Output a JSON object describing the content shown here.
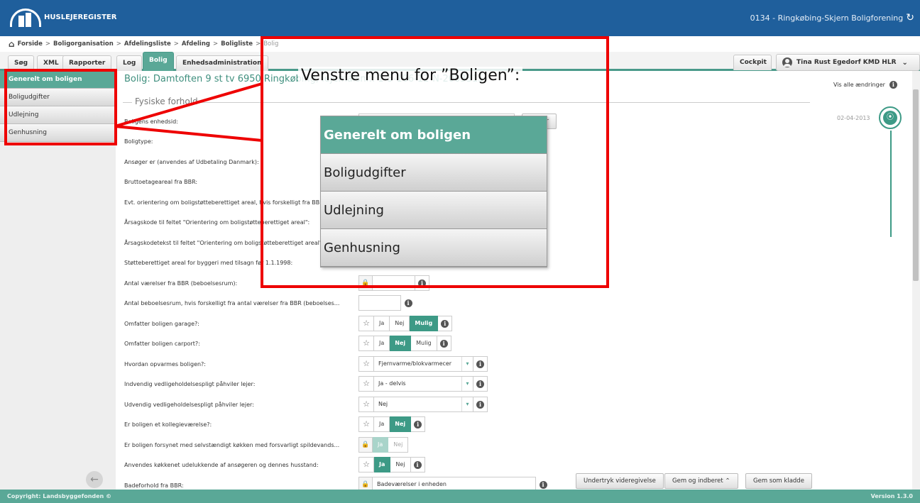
{
  "app": {
    "name": "HUSLEJEREGISTER",
    "organization": "0134 - Ringkøbing-Skjern Boligforening"
  },
  "breadcrumb": {
    "items": [
      "Forside",
      "Boligorganisation",
      "Afdelingsliste",
      "Afdeling",
      "Boligliste"
    ],
    "separator": ">",
    "current": "Bolig"
  },
  "tabs": [
    "Søg",
    "XML",
    "Rapporter",
    "Log",
    "Bolig",
    "Enhedsadministration"
  ],
  "active_tab": "Bolig",
  "top_right": {
    "cockpit": "Cockpit",
    "user": "Tina Rust Egedorf KMD HLR"
  },
  "sidebar": {
    "items": [
      {
        "label": "Generelt om boligen",
        "active": true
      },
      {
        "label": "Boligudgifter",
        "active": false
      },
      {
        "label": "Udlejning",
        "active": false
      },
      {
        "label": "Genhusning",
        "active": false
      }
    ]
  },
  "main": {
    "title": "Bolig: Damtoften 9 st tv 6950 Ringkøbing, lejemålsnr.: 1-5-106-12-N-2003315",
    "section": "Fysiske forhold",
    "rows": [
      {
        "label": "Boligens enhedsid:"
      },
      {
        "label": "Boligtype:"
      },
      {
        "label": "Ansøger er (anvendes af Udbetaling Danmark):"
      },
      {
        "label": "Bruttoetageareal fra BBR:"
      },
      {
        "label": "Evt. orientering om boligstøtteberettiget areal, hvis forskelligt fra BBR:"
      },
      {
        "label": "Årsagskode til feltet \"Orientering om boligstøtteberettiget areal\":"
      },
      {
        "label": "Årsagskodetekst til feltet \"Orientering om boligstøtteberettiget areal\":"
      },
      {
        "label": "Støtteberettiget areal for byggeri med tilsagn før 1.1.1998:"
      },
      {
        "label": "Antal værelser fra BBR (beboelsesrum):"
      },
      {
        "label": "Antal beboelsesrum, hvis forskelligt fra antal værelser fra BBR (beboelses..."
      },
      {
        "label": "Omfatter boligen garage?:",
        "options": [
          "Ja",
          "Nej",
          "Mulig"
        ],
        "selected": "Mulig"
      },
      {
        "label": "Omfatter boligen carport?:",
        "options": [
          "Ja",
          "Nej",
          "Mulig"
        ],
        "selected": "Nej"
      },
      {
        "label": "Hvordan opvarmes boligen?:",
        "value": "Fjernvarme/blokvarmecer"
      },
      {
        "label": "Indvendig vedligeholdelsespligt påhviler lejer:",
        "value": "Ja - delvis"
      },
      {
        "label": "Udvendig vedligeholdelsespligt påhviler lejer:",
        "value": "Nej"
      },
      {
        "label": "Er boligen et kollegieværelse?:",
        "options": [
          "Ja",
          "Nej"
        ],
        "selected": "Nej"
      },
      {
        "label": "Er boligen forsynet med selvstændigt køkken med forsvarligt spildevands...",
        "options": [
          "Ja",
          "Nej"
        ],
        "selected": "Ja"
      },
      {
        "label": "Anvendes køkkenet udelukkende af ansøgeren og dennes husstand:",
        "options": [
          "Ja",
          "Nej"
        ],
        "selected": "Ja"
      },
      {
        "label": "Badeforhold fra BBR:",
        "value": "Badeværelser i enheden"
      }
    ],
    "copy_button": "Kopier"
  },
  "right_panel": {
    "show_all_changes": "Vis alle ændringer",
    "date": "02-04-2013"
  },
  "actions": {
    "suppress": "Undertryk videregivelse",
    "save_submit": "Gem og indberet",
    "save_draft": "Gem som kladde"
  },
  "footer": {
    "copyright": "Copyright: Landsbyggefonden ©",
    "version": "Version 1.3.0"
  },
  "annotation": {
    "title": "Venstre menu for ”Boligen”:",
    "menu": [
      "Generelt om boligen",
      "Boligudgifter",
      "Udlejning",
      "Genhusning"
    ],
    "highlight_color": "#ee0000"
  },
  "colors": {
    "header": "#1f5f9c",
    "accent": "#5aa897",
    "accent_dark": "#3d9a86"
  }
}
